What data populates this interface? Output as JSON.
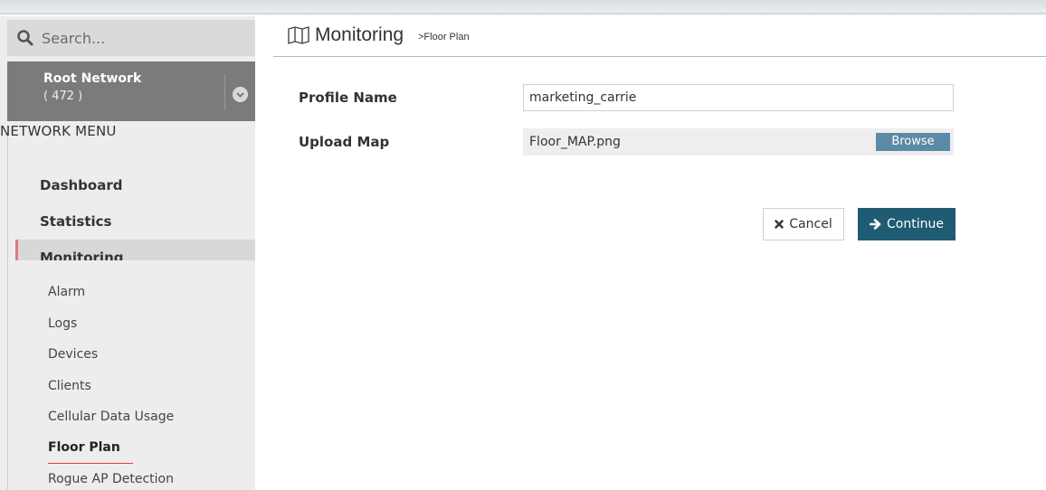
{
  "search": {
    "placeholder": "Search..."
  },
  "network": {
    "name": "Root Network",
    "count": "( 472 )"
  },
  "sidebar": {
    "heading": "NETWORK MENU",
    "items": [
      {
        "label": "Dashboard"
      },
      {
        "label": "Statistics"
      },
      {
        "label": "Monitoring"
      }
    ],
    "submenu": [
      {
        "label": "Alarm"
      },
      {
        "label": "Logs"
      },
      {
        "label": "Devices"
      },
      {
        "label": "Clients"
      },
      {
        "label": "Cellular Data Usage"
      },
      {
        "label": "Floor Plan"
      },
      {
        "label": "Rogue AP Detection"
      }
    ],
    "active_submenu": "Floor Plan"
  },
  "header": {
    "title": "Monitoring",
    "breadcrumb": ">Floor Plan"
  },
  "form": {
    "profile_name_label": "Profile Name",
    "profile_name_value": "marketing_carrie",
    "upload_map_label": "Upload Map",
    "upload_map_file": "Floor_MAP.png",
    "browse_label": "Browse",
    "cancel_label": "Cancel",
    "continue_label": "Continue"
  },
  "icons": {
    "search": "search-icon",
    "chevron": "chevron-down-circle-icon",
    "map": "map-icon",
    "cancel": "times-icon",
    "continue": "arrow-right-icon"
  },
  "colors": {
    "accent": "#1f5b72",
    "browse": "#5a8aa6",
    "active_marker": "#e07a7a",
    "underline": "#e03b3b"
  }
}
